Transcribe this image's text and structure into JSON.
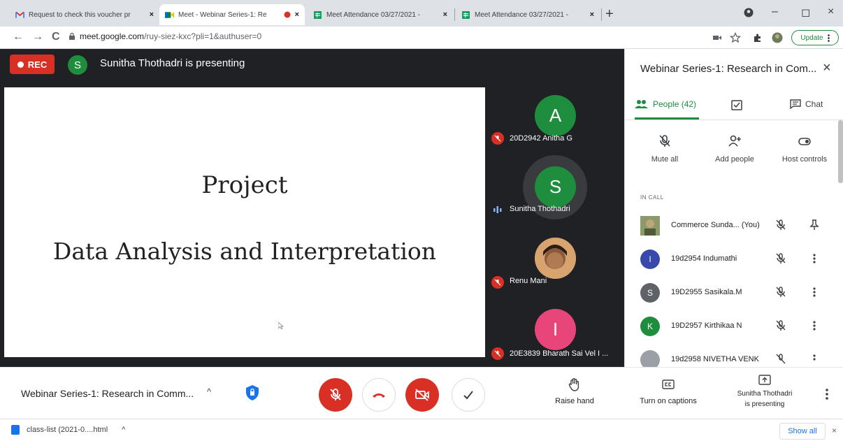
{
  "browser": {
    "tabs": [
      {
        "title": "Request to check this voucher pr",
        "icon": "gmail-icon",
        "close": "×"
      },
      {
        "title": "Meet - Webinar Series-1: Re",
        "icon": "meet-icon",
        "close": "×"
      },
      {
        "title": "Meet Attendance 03/27/2021 - ",
        "icon": "sheets-icon",
        "close": "×"
      },
      {
        "title": "Meet Attendance 03/27/2021 - ",
        "icon": "sheets-icon",
        "close": "×"
      }
    ],
    "new_tab": "+",
    "window": {
      "minimize": "–",
      "restore": "◻",
      "close": "×"
    },
    "nav": {
      "back": "←",
      "forward": "→",
      "reload": "C"
    },
    "url_host": "meet.google.com",
    "url_path": "/ruy-siez-kxc?pli=1&authuser=0",
    "update_label": "Update"
  },
  "meet": {
    "rec_label": "REC",
    "presenter_initial": "S",
    "presenter_text": "Sunitha Thothadri is presenting",
    "slide": {
      "line1": "Project",
      "line2": "Data Analysis and Interpretation"
    },
    "tiles": [
      {
        "initial": "A",
        "name": "20D2942 Anitha G",
        "color": "#1e8e3e",
        "status": "muted"
      },
      {
        "initial": "S",
        "name": "Sunitha Thothadri",
        "color": "#1e8e3e",
        "status": "speaking"
      },
      {
        "initial": "",
        "name": "Renu Mani",
        "color": "#c98b5e",
        "status": "muted"
      },
      {
        "initial": "I",
        "name": "20E3839 Bharath Sai Vel I ...",
        "color": "#e8457a",
        "status": "muted"
      }
    ]
  },
  "panel": {
    "title": "Webinar Series-1: Research in Com...",
    "close": "×",
    "tabs": {
      "people": "People (42)",
      "chat": "Chat"
    },
    "actions": {
      "mute_all": "Mute all",
      "add_people": "Add people",
      "host_controls": "Host controls"
    },
    "in_call_label": "IN CALL",
    "participants": [
      {
        "initial": "",
        "name": "Commerce Sunda... (You)",
        "color": "#7a8a5c",
        "secondary": "pin"
      },
      {
        "initial": "I",
        "name": "19d2954 Indumathi",
        "color": "#3949ab",
        "secondary": "more"
      },
      {
        "initial": "S",
        "name": "19D2955 Sasikala.M",
        "color": "#5f6368",
        "secondary": "more"
      },
      {
        "initial": "K",
        "name": "19D2957 Kirthikaa N",
        "color": "#1e8e3e",
        "secondary": "more"
      },
      {
        "initial": "",
        "name": "19d2958 NIVETHA VENK",
        "color": "#9aa0a6",
        "secondary": "more"
      }
    ]
  },
  "controls": {
    "meeting_name": "Webinar Series-1: Research in Comm...",
    "caret": "^",
    "raise_hand": "Raise hand",
    "captions": "Turn on captions",
    "presenting_line1": "Sunitha Thothadri",
    "presenting_line2": "is presenting"
  },
  "downloads": {
    "file": "class-list (2021-0....html",
    "caret": "^",
    "show_all": "Show all",
    "close": "×"
  }
}
